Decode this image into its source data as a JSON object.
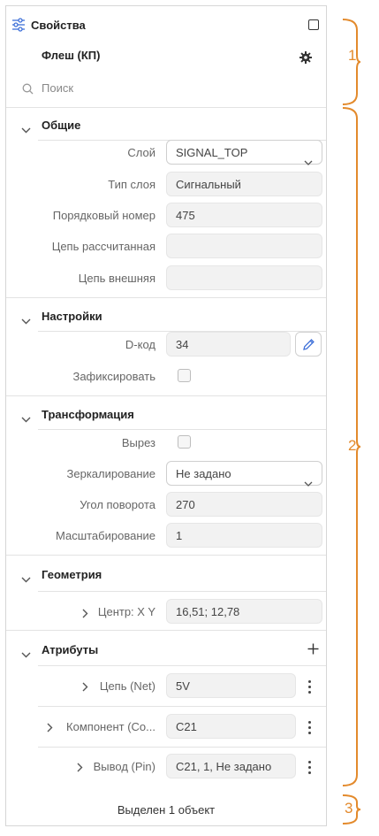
{
  "header": {
    "title": "Свойства",
    "object_name": "Флеш (КП)",
    "search_placeholder": "Поиск"
  },
  "general": {
    "title": "Общие",
    "layer_label": "Слой",
    "layer_value": "SIGNAL_TOP",
    "layer_type_label": "Тип слоя",
    "layer_type_value": "Сигнальный",
    "ordinal_label": "Порядковый номер",
    "ordinal_value": "475",
    "net_calc_label": "Цепь рассчитанная",
    "net_calc_value": "",
    "net_ext_label": "Цепь внешняя",
    "net_ext_value": ""
  },
  "settings": {
    "title": "Настройки",
    "dcode_label": "D-код",
    "dcode_value": "34",
    "lock_label": "Зафиксировать"
  },
  "transform": {
    "title": "Трансформация",
    "cutout_label": "Вырез",
    "mirror_label": "Зеркалирование",
    "mirror_value": "Не задано",
    "rotation_label": "Угол поворота",
    "rotation_value": "270",
    "scale_label": "Масштабирование",
    "scale_value": "1"
  },
  "geometry": {
    "title": "Геометрия",
    "center_label": "Центр: X Y",
    "center_value": "16,51; 12,78"
  },
  "attributes": {
    "title": "Атрибуты",
    "items": [
      {
        "label": "Цепь (Net)",
        "value": "5V"
      },
      {
        "label": "Компонент (Co...",
        "value": "C21"
      },
      {
        "label": "Вывод (Pin)",
        "value": "C21, 1, Не задано"
      }
    ]
  },
  "footer": {
    "status": "Выделен 1 объект"
  },
  "callouts": {
    "one": "1",
    "two": "2",
    "three": "3"
  },
  "colors": {
    "accent_orange": "#e38a2c",
    "icon_blue": "#3d6fd8"
  }
}
